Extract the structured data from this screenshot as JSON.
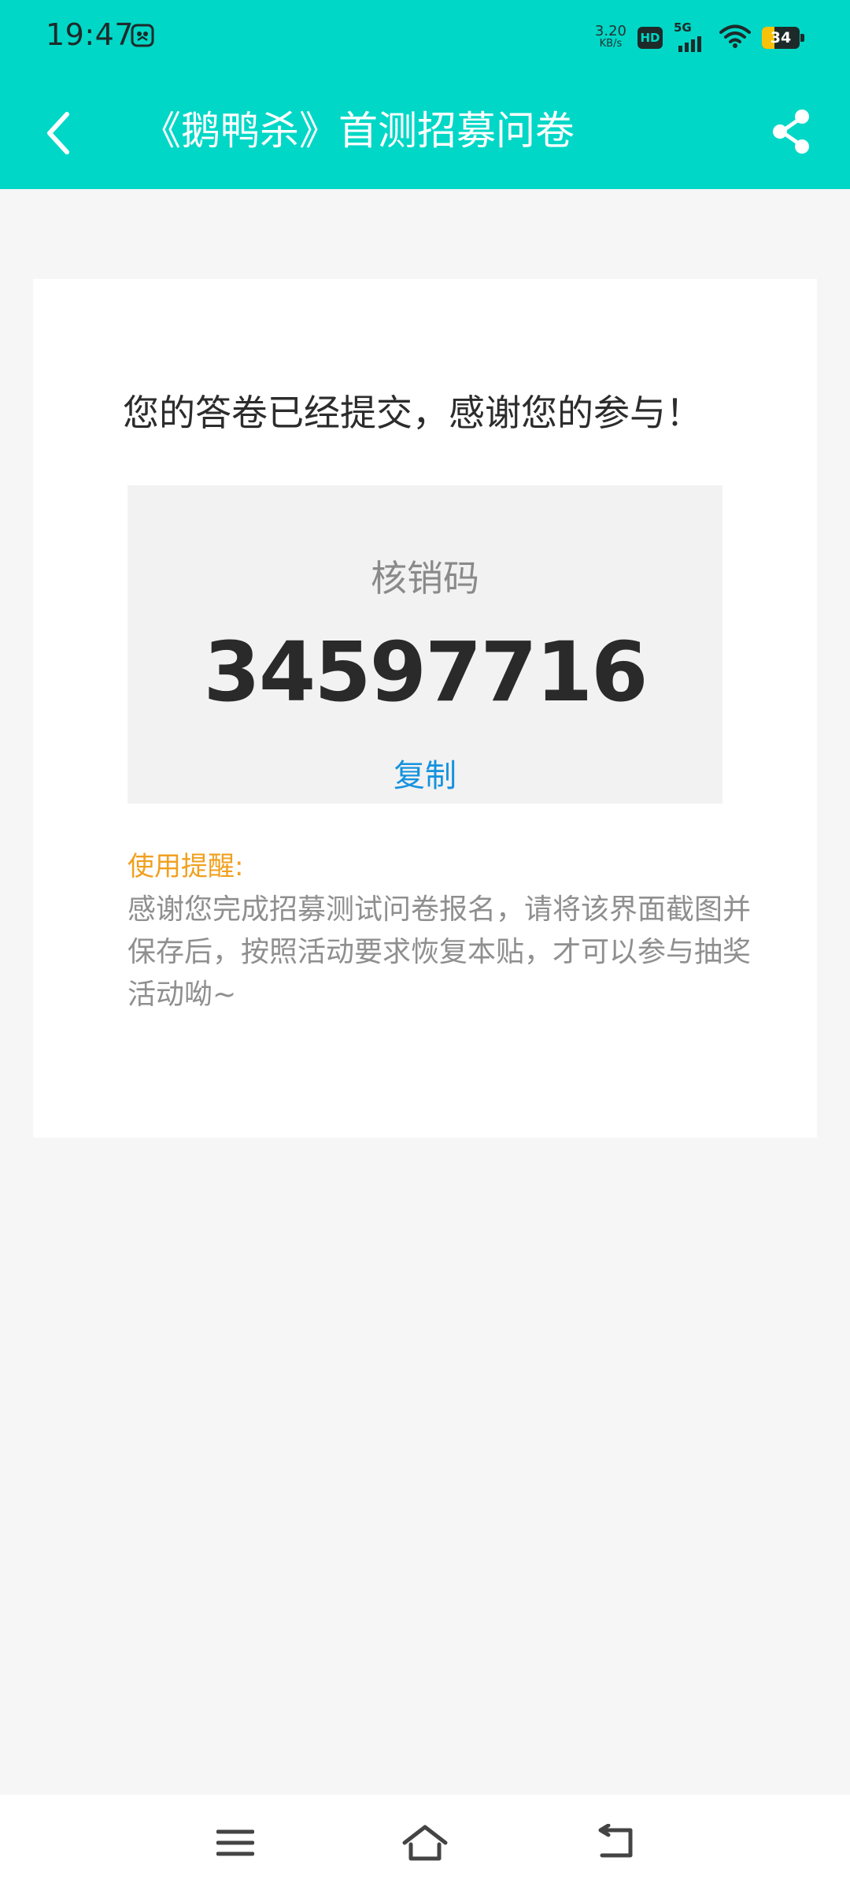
{
  "status_bar": {
    "time": "19:47",
    "net_speed_value": "3.20",
    "net_speed_unit": "KB/s",
    "hd_label": "HD",
    "network_label": "5G",
    "battery_level": "34"
  },
  "toolbar": {
    "title": "《鹅鸭杀》首测招募问卷"
  },
  "card": {
    "success_message": "您的答卷已经提交，感谢您的参与！",
    "code_label": "核销码",
    "code_value": "34597716",
    "copy_label": "复制",
    "tip_title": "使用提醒:",
    "tip_text": "感谢您完成招募测试问卷报名，请将该界面截图并保存后，按照活动要求恢复本贴，才可以参与抽奖活动呦~"
  },
  "colors": {
    "header": "#00d7c6",
    "copy_link": "#1592de",
    "tip_title": "#f0a020",
    "battery_fill": "#f8c20a"
  },
  "icons": {
    "back": "chevron-left-icon",
    "share": "share-icon",
    "menu": "menu-icon",
    "home": "home-icon",
    "nav_back": "back-icon"
  }
}
